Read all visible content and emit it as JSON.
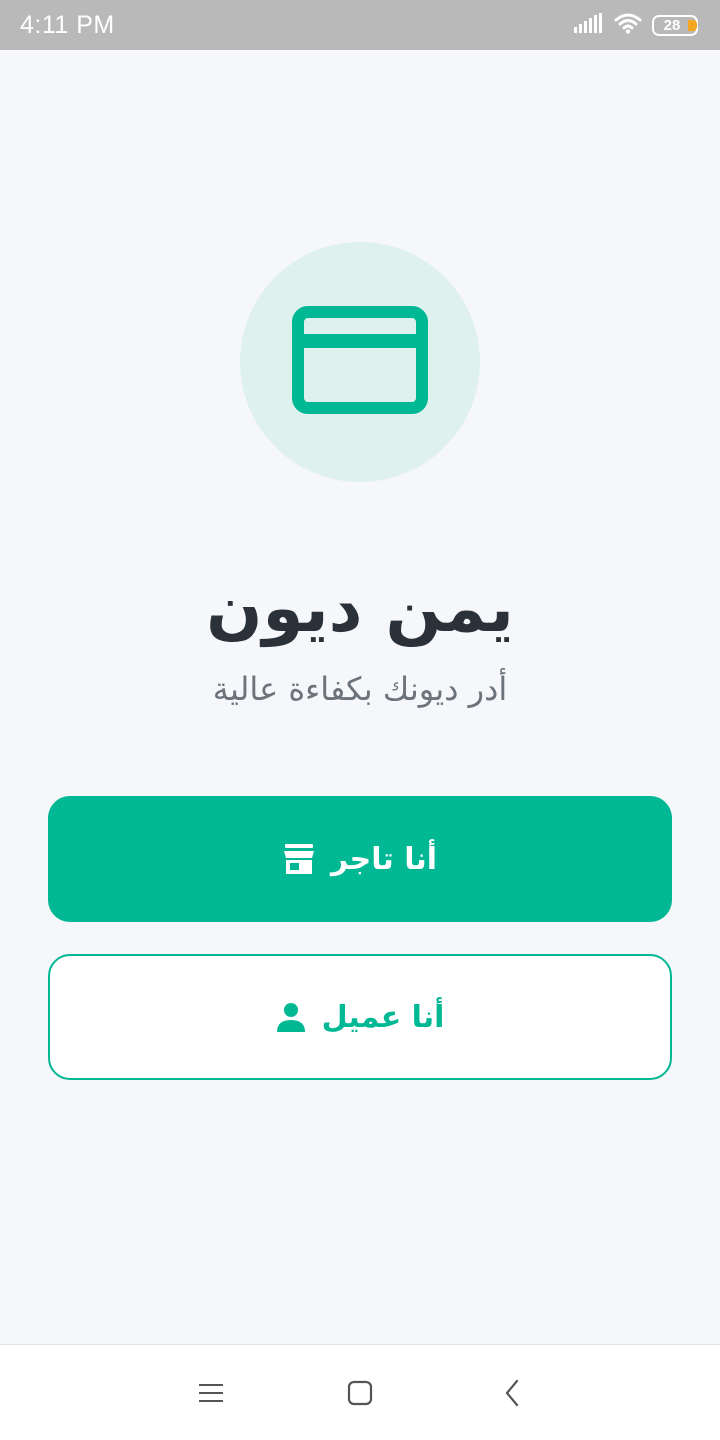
{
  "status_bar": {
    "time": "4:11 PM",
    "battery_level": "28",
    "icons": [
      "signal-icon",
      "wifi-icon",
      "battery-icon"
    ]
  },
  "app": {
    "logo_icon": "credit-card-icon",
    "title": "يمن ديون",
    "subtitle": "أدر ديونك بكفاءة عالية"
  },
  "buttons": {
    "merchant": {
      "label": "أنا تاجر",
      "icon": "store-icon"
    },
    "customer": {
      "label": "أنا عميل",
      "icon": "person-icon"
    }
  },
  "nav_bar": {
    "icons": [
      "menu-icon",
      "home-icon",
      "back-icon"
    ]
  },
  "colors": {
    "primary": "#00b894",
    "logo_bg": "#dff1ee",
    "title": "#2b3138",
    "subtitle": "#6d737a",
    "battery_accent": "#f5a623"
  }
}
